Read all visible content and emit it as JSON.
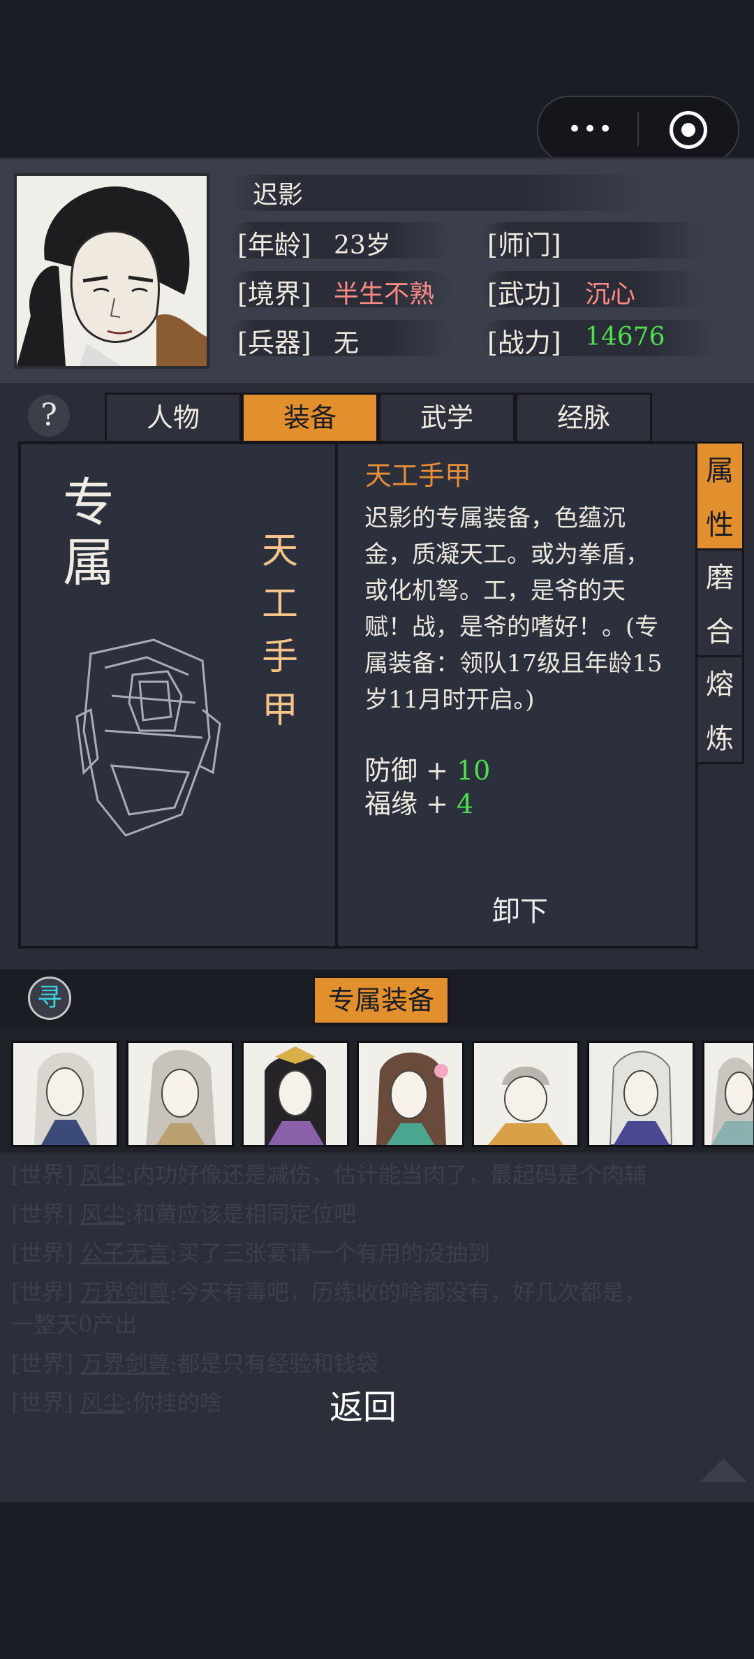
{
  "character": {
    "name": "迟影",
    "age_label": "[年龄]",
    "age_value": "23岁",
    "sect_label": "[师门]",
    "sect_value": "",
    "realm_label": "[境界]",
    "realm_value": "半生不熟",
    "skill_label": "[武功]",
    "skill_value": "沉心",
    "weapon_label": "[兵器]",
    "weapon_value": "无",
    "power_label": "[战力]",
    "power_value": "14676"
  },
  "tabs": [
    "人物",
    "装备",
    "武学",
    "经脉"
  ],
  "active_tab": "装备",
  "help_icon": "?",
  "equipment": {
    "slot_label": [
      "专",
      "属"
    ],
    "vertical_name": [
      "天",
      "工",
      "手",
      "甲"
    ],
    "name": "天工手甲",
    "description": "迟影的专属装备，色蕴沉金，质凝天工。或为拳盾，或化机弩。工，是爷的天赋！战，是爷的嗜好！。(专属装备：领队17级且年龄15岁11月时开启。)",
    "stats": [
      {
        "label": "防御 + ",
        "value": "10"
      },
      {
        "label": "福缘 + ",
        "value": "4"
      }
    ],
    "unequip_label": "卸下"
  },
  "side_tabs": [
    {
      "chars": [
        "属",
        "性"
      ]
    },
    {
      "chars": [
        "磨",
        "合"
      ]
    },
    {
      "chars": [
        "熔",
        "炼"
      ]
    }
  ],
  "seek_icon_char": "寻",
  "exclusive_button": "专属装备",
  "chat": [
    {
      "channel": "[世界]",
      "name": "风尘",
      "text": ":内功好像还是减伤，估计能当肉了，最起码是个肉辅"
    },
    {
      "channel": "[世界]",
      "name": "风尘",
      "text": ":和黄应该是相同定位吧"
    },
    {
      "channel": "[世界]",
      "name": "公子无言",
      "text": ":买了三张宴请一个有用的没抽到"
    },
    {
      "channel": "[世界]",
      "name": "万界剑尊",
      "text": ":今天有毒吧，历练收的啥都没有，好几次都是，"
    },
    {
      "channel": "",
      "name": "",
      "text": "一整天0产出"
    },
    {
      "channel": "[世界]",
      "name": "万界剑尊",
      "text": ":都是只有经验和钱袋"
    },
    {
      "channel": "[世界]",
      "name": "风尘",
      "text": ":你挂的啥"
    }
  ],
  "back_label": "返回",
  "colors": {
    "accent": "#e1902d",
    "power": "#4ee04e",
    "realm": "#ff8a84",
    "item_name": "#e98f37"
  }
}
